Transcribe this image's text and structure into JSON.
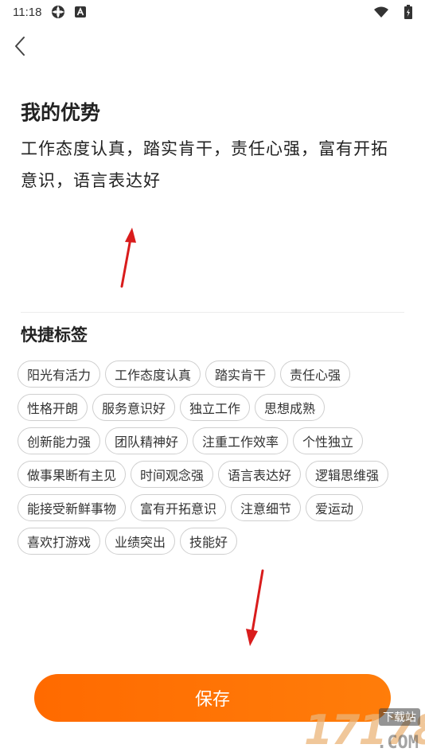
{
  "status_bar": {
    "time": "11:18",
    "left_icons": [
      "settings-flower-icon",
      "text-a-icon"
    ],
    "right_icons": [
      "wifi-icon",
      "battery-charging-icon"
    ]
  },
  "header": {
    "back_icon": "chevron-left-icon"
  },
  "advantage": {
    "title": "我的优势",
    "text": "工作态度认真，踏实肯干，责任心强，富有开拓意识，语言表达好"
  },
  "quick_tags": {
    "title": "快捷标签",
    "tags": [
      "阳光有活力",
      "工作态度认真",
      "踏实肯干",
      "责任心强",
      "性格开朗",
      "服务意识好",
      "独立工作",
      "思想成熟",
      "创新能力强",
      "团队精神好",
      "注重工作效率",
      "个性独立",
      "做事果断有主见",
      "时间观念强",
      "语言表达好",
      "逻辑思维强",
      "能接受新鲜事物",
      "富有开拓意识",
      "注意细节",
      "爱运动",
      "喜欢打游戏",
      "业绩突出",
      "技能好"
    ]
  },
  "save_button": {
    "label": "保存"
  },
  "colors": {
    "accent": "#ff6f00",
    "arrow": "#d91c1c",
    "tag_border": "#cfcfcf"
  },
  "watermark": {
    "digits": "17178",
    "badge": "下载站",
    "domain": ".COM"
  }
}
